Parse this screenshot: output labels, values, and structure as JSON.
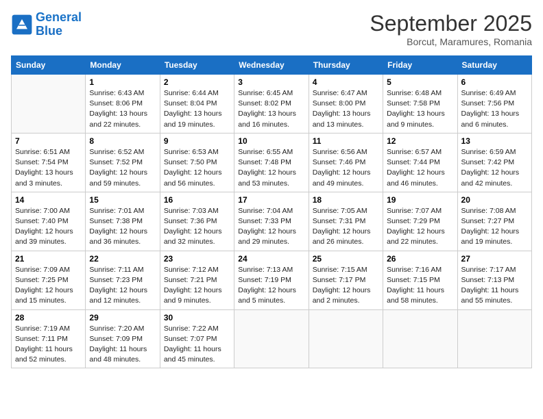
{
  "logo": {
    "line1": "General",
    "line2": "Blue"
  },
  "title": "September 2025",
  "subtitle": "Borcut, Maramures, Romania",
  "weekdays": [
    "Sunday",
    "Monday",
    "Tuesday",
    "Wednesday",
    "Thursday",
    "Friday",
    "Saturday"
  ],
  "weeks": [
    [
      {
        "day": "",
        "info": ""
      },
      {
        "day": "1",
        "info": "Sunrise: 6:43 AM\nSunset: 8:06 PM\nDaylight: 13 hours\nand 22 minutes."
      },
      {
        "day": "2",
        "info": "Sunrise: 6:44 AM\nSunset: 8:04 PM\nDaylight: 13 hours\nand 19 minutes."
      },
      {
        "day": "3",
        "info": "Sunrise: 6:45 AM\nSunset: 8:02 PM\nDaylight: 13 hours\nand 16 minutes."
      },
      {
        "day": "4",
        "info": "Sunrise: 6:47 AM\nSunset: 8:00 PM\nDaylight: 13 hours\nand 13 minutes."
      },
      {
        "day": "5",
        "info": "Sunrise: 6:48 AM\nSunset: 7:58 PM\nDaylight: 13 hours\nand 9 minutes."
      },
      {
        "day": "6",
        "info": "Sunrise: 6:49 AM\nSunset: 7:56 PM\nDaylight: 13 hours\nand 6 minutes."
      }
    ],
    [
      {
        "day": "7",
        "info": "Sunrise: 6:51 AM\nSunset: 7:54 PM\nDaylight: 13 hours\nand 3 minutes."
      },
      {
        "day": "8",
        "info": "Sunrise: 6:52 AM\nSunset: 7:52 PM\nDaylight: 12 hours\nand 59 minutes."
      },
      {
        "day": "9",
        "info": "Sunrise: 6:53 AM\nSunset: 7:50 PM\nDaylight: 12 hours\nand 56 minutes."
      },
      {
        "day": "10",
        "info": "Sunrise: 6:55 AM\nSunset: 7:48 PM\nDaylight: 12 hours\nand 53 minutes."
      },
      {
        "day": "11",
        "info": "Sunrise: 6:56 AM\nSunset: 7:46 PM\nDaylight: 12 hours\nand 49 minutes."
      },
      {
        "day": "12",
        "info": "Sunrise: 6:57 AM\nSunset: 7:44 PM\nDaylight: 12 hours\nand 46 minutes."
      },
      {
        "day": "13",
        "info": "Sunrise: 6:59 AM\nSunset: 7:42 PM\nDaylight: 12 hours\nand 42 minutes."
      }
    ],
    [
      {
        "day": "14",
        "info": "Sunrise: 7:00 AM\nSunset: 7:40 PM\nDaylight: 12 hours\nand 39 minutes."
      },
      {
        "day": "15",
        "info": "Sunrise: 7:01 AM\nSunset: 7:38 PM\nDaylight: 12 hours\nand 36 minutes."
      },
      {
        "day": "16",
        "info": "Sunrise: 7:03 AM\nSunset: 7:36 PM\nDaylight: 12 hours\nand 32 minutes."
      },
      {
        "day": "17",
        "info": "Sunrise: 7:04 AM\nSunset: 7:33 PM\nDaylight: 12 hours\nand 29 minutes."
      },
      {
        "day": "18",
        "info": "Sunrise: 7:05 AM\nSunset: 7:31 PM\nDaylight: 12 hours\nand 26 minutes."
      },
      {
        "day": "19",
        "info": "Sunrise: 7:07 AM\nSunset: 7:29 PM\nDaylight: 12 hours\nand 22 minutes."
      },
      {
        "day": "20",
        "info": "Sunrise: 7:08 AM\nSunset: 7:27 PM\nDaylight: 12 hours\nand 19 minutes."
      }
    ],
    [
      {
        "day": "21",
        "info": "Sunrise: 7:09 AM\nSunset: 7:25 PM\nDaylight: 12 hours\nand 15 minutes."
      },
      {
        "day": "22",
        "info": "Sunrise: 7:11 AM\nSunset: 7:23 PM\nDaylight: 12 hours\nand 12 minutes."
      },
      {
        "day": "23",
        "info": "Sunrise: 7:12 AM\nSunset: 7:21 PM\nDaylight: 12 hours\nand 9 minutes."
      },
      {
        "day": "24",
        "info": "Sunrise: 7:13 AM\nSunset: 7:19 PM\nDaylight: 12 hours\nand 5 minutes."
      },
      {
        "day": "25",
        "info": "Sunrise: 7:15 AM\nSunset: 7:17 PM\nDaylight: 12 hours\nand 2 minutes."
      },
      {
        "day": "26",
        "info": "Sunrise: 7:16 AM\nSunset: 7:15 PM\nDaylight: 11 hours\nand 58 minutes."
      },
      {
        "day": "27",
        "info": "Sunrise: 7:17 AM\nSunset: 7:13 PM\nDaylight: 11 hours\nand 55 minutes."
      }
    ],
    [
      {
        "day": "28",
        "info": "Sunrise: 7:19 AM\nSunset: 7:11 PM\nDaylight: 11 hours\nand 52 minutes."
      },
      {
        "day": "29",
        "info": "Sunrise: 7:20 AM\nSunset: 7:09 PM\nDaylight: 11 hours\nand 48 minutes."
      },
      {
        "day": "30",
        "info": "Sunrise: 7:22 AM\nSunset: 7:07 PM\nDaylight: 11 hours\nand 45 minutes."
      },
      {
        "day": "",
        "info": ""
      },
      {
        "day": "",
        "info": ""
      },
      {
        "day": "",
        "info": ""
      },
      {
        "day": "",
        "info": ""
      }
    ]
  ]
}
